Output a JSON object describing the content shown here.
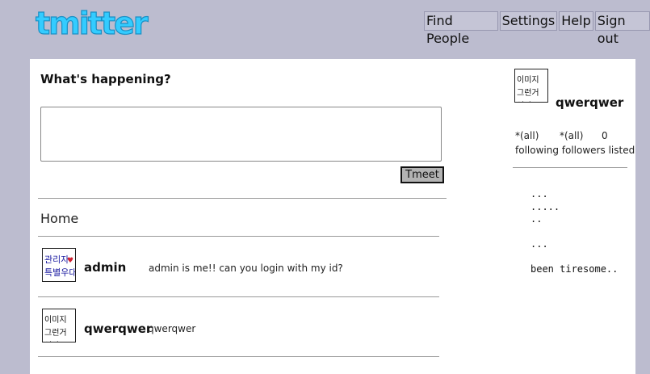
{
  "logo": {
    "text": "tmitter"
  },
  "topnav": {
    "items": [
      "Find People",
      "Settings",
      "Help",
      "Sign out"
    ]
  },
  "compose": {
    "prompt": "What's happening?",
    "textarea_value": "",
    "button_label": "Tmeet"
  },
  "timeline": {
    "title": "Home",
    "tweets": [
      {
        "user": "admin",
        "text": "admin is me!! can you login with my id?",
        "avatar": "admin-avatar-icon",
        "avatar_text": "관리자 특별우대"
      },
      {
        "user": "qwerqwer",
        "text": "qwerqwer",
        "avatar": "user-avatar-icon",
        "avatar_text": "이미지 그런거 없다"
      }
    ]
  },
  "sidebar": {
    "avatar_text": "이미지 그런거 없다",
    "username": "qwerqwer",
    "stats": [
      {
        "value": "*(all)",
        "label": "following"
      },
      {
        "value": "*(all)",
        "label": "followers"
      },
      {
        "value": "0",
        "label": "listed"
      }
    ],
    "bio_lines": [
      "...",
      ".....",
      "..",
      "",
      "...",
      "",
      "been tiresome.."
    ]
  },
  "colors": {
    "background": "#bcbccf",
    "panel": "#ffffff",
    "logo_blue": "#33ccff"
  }
}
